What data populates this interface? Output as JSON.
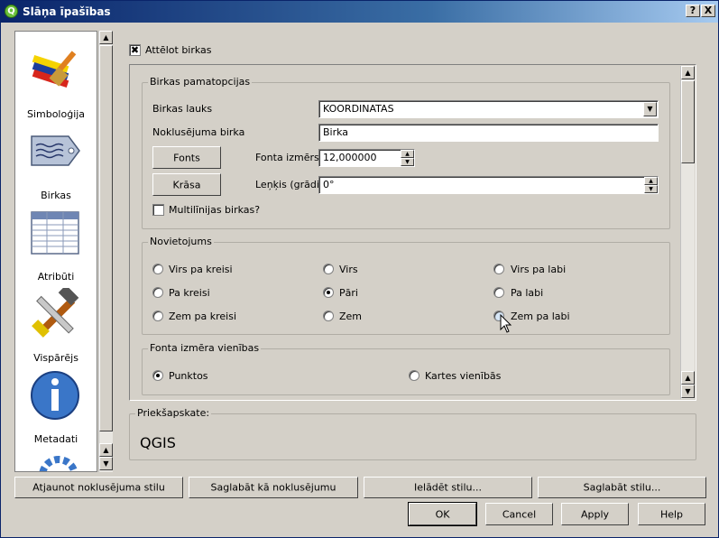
{
  "window": {
    "title": "Slāņa īpašības",
    "help_btn": "?",
    "close_btn": "X"
  },
  "sidebar": {
    "items": [
      {
        "label": "Simboloģija",
        "icon": "paintbrush-icon"
      },
      {
        "label": "Birkas",
        "icon": "label-tag-icon"
      },
      {
        "label": "Atribūti",
        "icon": "attribute-table-icon"
      },
      {
        "label": "Vispārējs",
        "icon": "tools-icon"
      },
      {
        "label": "Metadati",
        "icon": "info-icon"
      }
    ]
  },
  "labels_tab": {
    "display_labels": {
      "label": "Attēlot birkas",
      "checked": true
    },
    "basic": {
      "title": "Birkas pamatopcijas",
      "field_label": "Birkas lauks",
      "field_value": "KOORDINATAS",
      "default_label": "Noklusējuma birka",
      "default_value": "Birka",
      "fonts_button": "Fonts",
      "font_size_label": "Fonta izmērs",
      "font_size_value": "12,000000",
      "color_button": "Krāsa",
      "angle_label": "Leņķis (grādi)",
      "angle_value": "0°",
      "multiline_label": "Multilīnijas birkas?",
      "multiline_checked": false
    },
    "placement": {
      "title": "Novietojums",
      "options": [
        {
          "label": "Virs pa kreisi",
          "selected": false
        },
        {
          "label": "Virs",
          "selected": false
        },
        {
          "label": "Virs pa labi",
          "selected": false
        },
        {
          "label": "Pa kreisi",
          "selected": false
        },
        {
          "label": "Pāri",
          "selected": true
        },
        {
          "label": "Pa labi",
          "selected": false
        },
        {
          "label": "Zem pa kreisi",
          "selected": false
        },
        {
          "label": "Zem",
          "selected": false
        },
        {
          "label": "Zem pa labi",
          "selected": false
        }
      ]
    },
    "font_units": {
      "title": "Fonta izmēra vienības",
      "points": "Punktos",
      "map_units": "Kartes vienībās",
      "selected": "Punktos"
    },
    "preview": {
      "title": "Priekšapskate:",
      "text": "QGIS"
    }
  },
  "style_buttons": {
    "restore": "Atjaunot noklusējuma stilu",
    "save_default": "Saglabāt kā noklusējumu",
    "load": "Ielādēt stilu...",
    "save": "Saglabāt stilu..."
  },
  "dialog_buttons": {
    "ok": "OK",
    "cancel": "Cancel",
    "apply": "Apply",
    "help": "Help"
  }
}
